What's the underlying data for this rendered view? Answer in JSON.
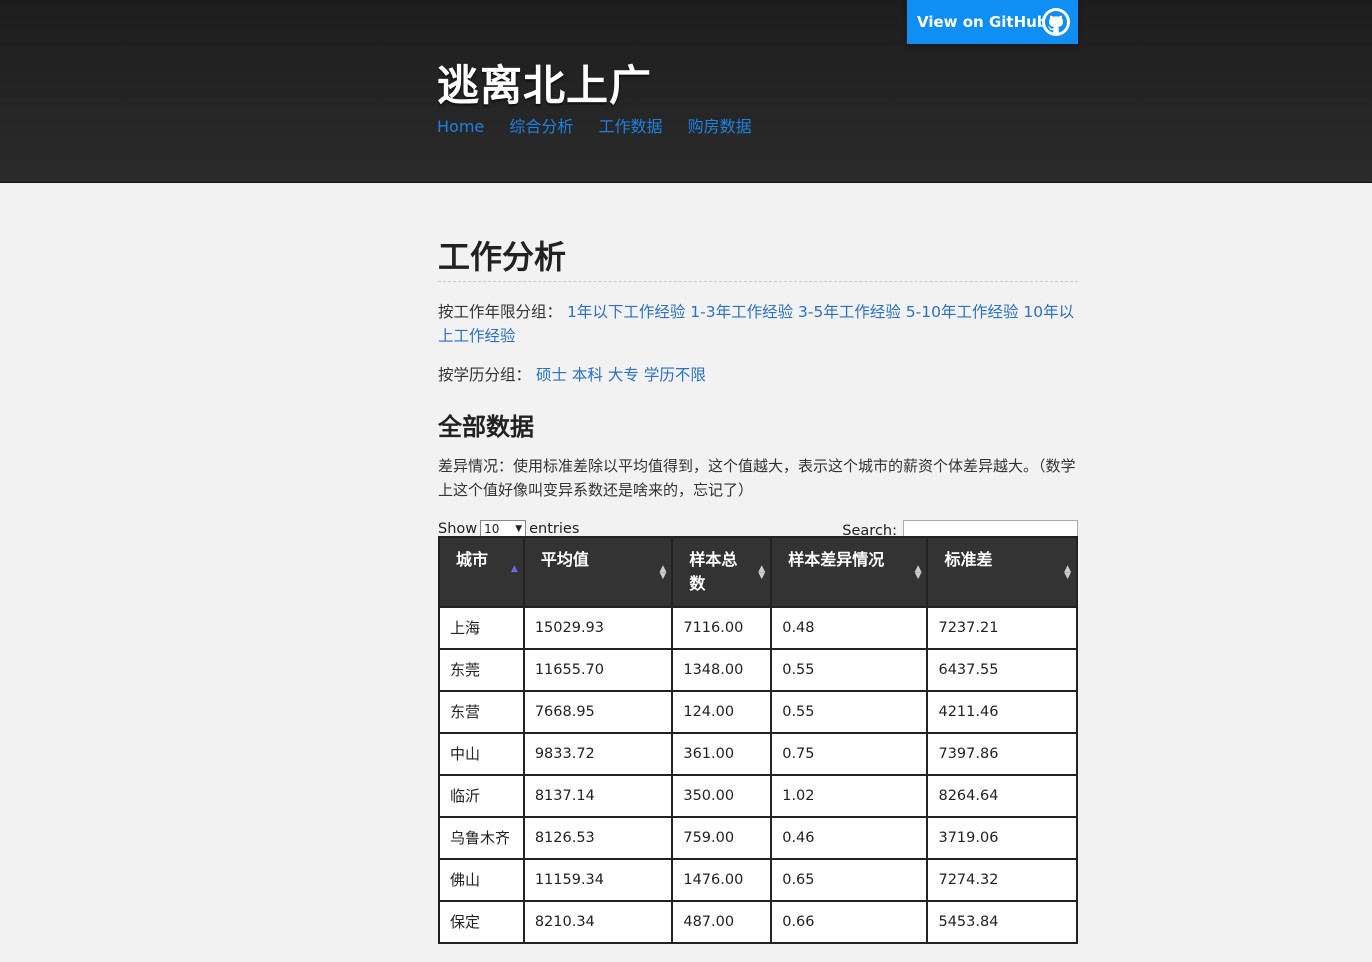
{
  "header": {
    "site_title": "逃离北上广",
    "github_label": "View on GitHub",
    "nav": [
      "Home",
      "综合分析",
      "工作数据",
      "购房数据"
    ]
  },
  "page": {
    "title": "工作分析",
    "filter_experience_label": "按工作年限分组：",
    "filter_experience_links": [
      "1年以下工作经验",
      "1-3年工作经验",
      "3-5年工作经验",
      "5-10年工作经验",
      "10年以上工作经验"
    ],
    "filter_education_label": "按学历分组：",
    "filter_education_links": [
      "硕士",
      "本科",
      "大专",
      "学历不限"
    ],
    "section_title": "全部数据",
    "description": "差异情况：使用标准差除以平均值得到，这个值越大，表示这个城市的薪资个体差异越大。（数学上这个值好像叫变异系数还是啥来的，忘记了）"
  },
  "datatable": {
    "show_label": "Show",
    "entries_value": "10",
    "entries_label": "entries",
    "search_label": "Search:",
    "columns": [
      "城市",
      "平均值",
      "样本总数",
      "样本差异情况",
      "标准差"
    ],
    "rows": [
      [
        "上海",
        "15029.93",
        "7116.00",
        "0.48",
        "7237.21"
      ],
      [
        "东莞",
        "11655.70",
        "1348.00",
        "0.55",
        "6437.55"
      ],
      [
        "东营",
        "7668.95",
        "124.00",
        "0.55",
        "4211.46"
      ],
      [
        "中山",
        "9833.72",
        "361.00",
        "0.75",
        "7397.86"
      ],
      [
        "临沂",
        "8137.14",
        "350.00",
        "1.02",
        "8264.64"
      ],
      [
        "乌鲁木齐",
        "8126.53",
        "759.00",
        "0.46",
        "3719.06"
      ],
      [
        "佛山",
        "11159.34",
        "1476.00",
        "0.65",
        "7274.32"
      ],
      [
        "保定",
        "8210.34",
        "487.00",
        "0.66",
        "5453.84"
      ]
    ]
  },
  "colors": {
    "accent_link": "#2a70c8",
    "github_button": "#0f8ef3",
    "header_bg": "#262626",
    "table_header_bg": "#333333"
  }
}
